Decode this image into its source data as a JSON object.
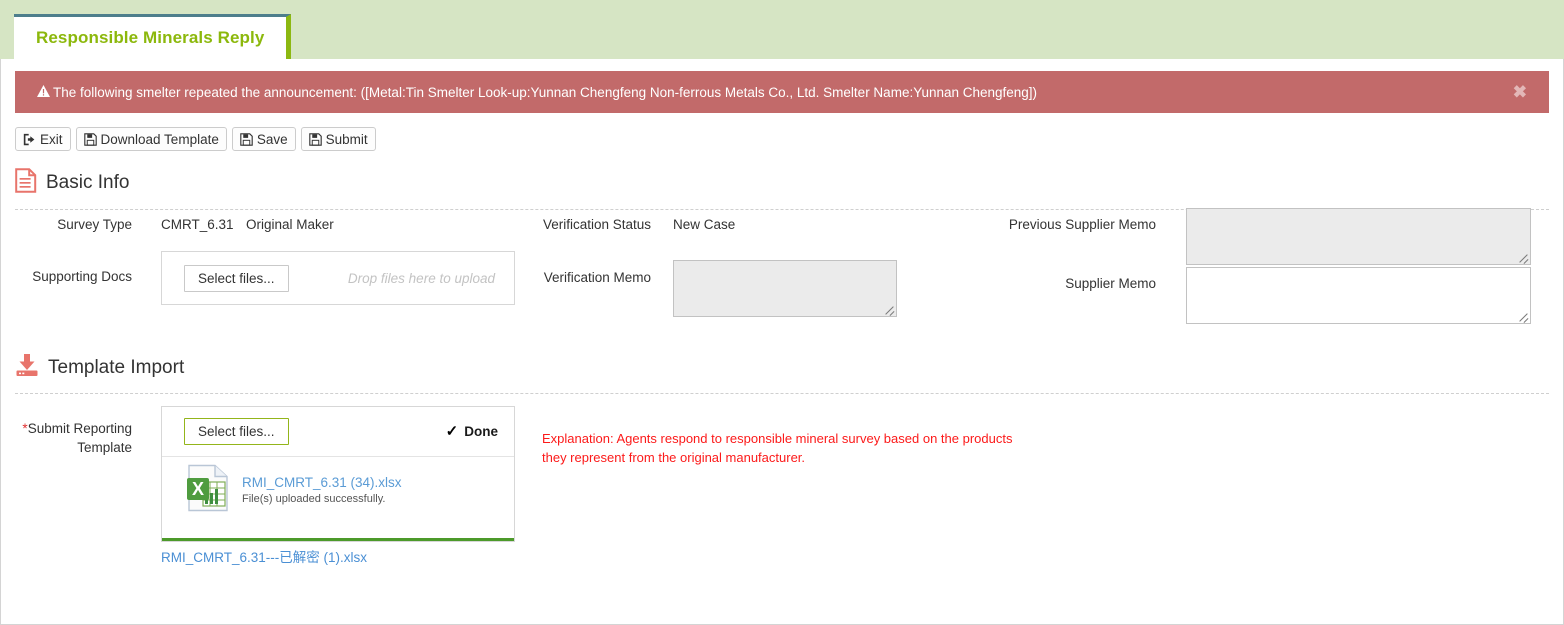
{
  "tab": {
    "label": "Responsible Minerals Reply"
  },
  "alert": {
    "icon": "warning-icon",
    "message": "The following smelter repeated the announcement: ([Metal:Tin Smelter Look-up:Yunnan Chengfeng Non-ferrous Metals Co., Ltd. Smelter Name:Yunnan Chengfeng])",
    "close_label": "✖",
    "background_color": "#c26a6a"
  },
  "toolbar": {
    "buttons": [
      {
        "label": "Exit",
        "icon": "sign-out-icon"
      },
      {
        "label": "Download Template",
        "icon": "save-icon"
      },
      {
        "label": "Save",
        "icon": "save-icon"
      },
      {
        "label": "Submit",
        "icon": "save-icon"
      }
    ]
  },
  "basic_info": {
    "section_title": "Basic Info",
    "section_icon": "document-icon",
    "fields": {
      "survey_type_label": "Survey Type",
      "survey_type_value": "CMRT_6.31",
      "original_maker_label": "Original Maker",
      "original_maker_value": "",
      "supporting_docs_label": "Supporting Docs",
      "verification_status_label": "Verification Status",
      "verification_status_value": "New Case",
      "verification_memo_label": "Verification Memo",
      "verification_memo_value": "",
      "previous_supplier_memo_label": "Previous Supplier Memo",
      "previous_supplier_memo_value": "",
      "supplier_memo_label": "Supplier Memo",
      "supplier_memo_value": ""
    },
    "supporting_docs_upload": {
      "select_label": "Select files...",
      "drop_hint": "Drop files here to upload"
    }
  },
  "template_import": {
    "section_title": "Template Import",
    "section_icon": "import-download-icon",
    "field_label_star": "*",
    "field_label": "Submit Reporting Template",
    "upload": {
      "select_label": "Select files...",
      "done_label": "Done",
      "done_icon": "check-icon",
      "file_icon": "excel-file-icon",
      "file_name": "RMI_CMRT_6.31 (34).xlsx",
      "file_status": "File(s) uploaded successfully.",
      "progress_percent": 100,
      "progress_color": "#4c9a2a"
    },
    "result_link": "RMI_CMRT_6.31---已解密 (1).xlsx",
    "explanation": "Explanation: Agents respond to responsible mineral survey based on the products they represent from the original manufacturer."
  }
}
